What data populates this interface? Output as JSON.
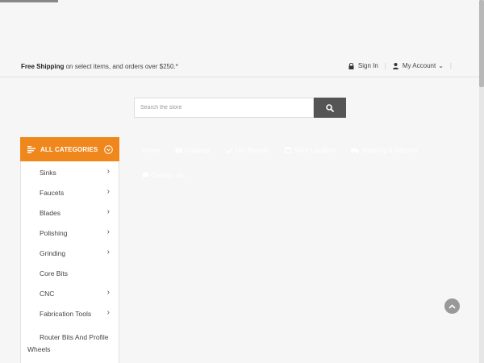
{
  "topbar": {
    "shipping_bold": "Free Shipping",
    "shipping_rest": " on select items, and orders over $250.*",
    "sign_in": "Sign In",
    "my_account": "My Account",
    "account_caret": "⌄",
    "divider": "|"
  },
  "search": {
    "placeholder": "Search the store"
  },
  "categories": {
    "header": "ALL CATEGORIES",
    "items": [
      {
        "label": "Sinks",
        "chevron": "›"
      },
      {
        "label": "Faucets",
        "chevron": "›"
      },
      {
        "label": "Blades",
        "chevron": "›"
      },
      {
        "label": "Polishing",
        "chevron": "›"
      },
      {
        "label": "Grinding",
        "chevron": "›"
      },
      {
        "label": "Core Bits",
        "chevron": ""
      },
      {
        "label": "CNC",
        "chevron": "›"
      },
      {
        "label": "Fabrication Tools",
        "chevron": "›"
      },
      {
        "label_line1": "Router Bits And Profile",
        "label_line2": "Wheels"
      }
    ]
  },
  "nav": {
    "home": "Home",
    "catalogs": "Catalogs",
    "our_brands": "Our Brands",
    "store_location": "Store Location",
    "shipping_returns": "Shipping & Returns",
    "contact_us": "Contact Us",
    "contact_caret": "⌄"
  },
  "colors": {
    "accent": "#f0871c",
    "search_button": "#555555",
    "background": "#f6f6f6"
  },
  "icons": {
    "sign_in": "lock-icon",
    "account": "user-icon",
    "search": "search-icon",
    "categories": "menu-lines-icon",
    "categories_toggle": "chevron-circle-down-icon",
    "catalogs": "book-icon",
    "our_brands": "check-icon",
    "store_location": "calendar-icon",
    "shipping_returns": "truck-icon",
    "contact_us": "chat-icon",
    "back_to_top": "chevron-up-icon"
  }
}
